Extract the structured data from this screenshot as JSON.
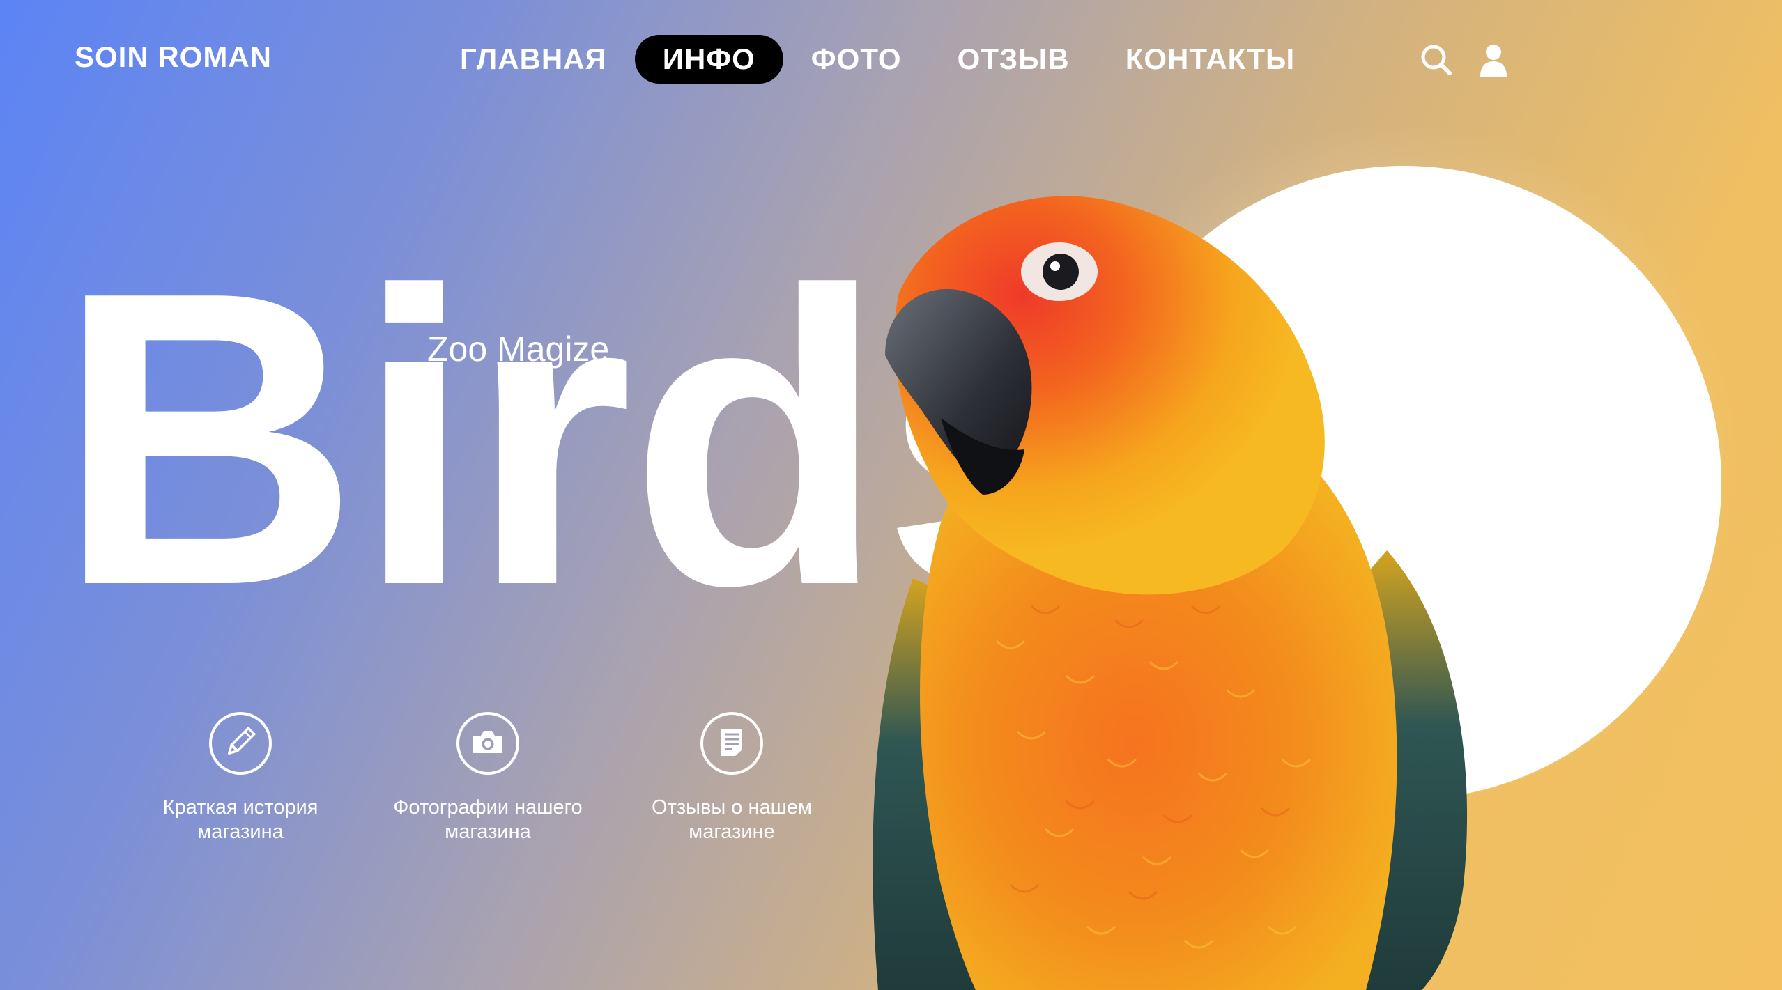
{
  "brand": {
    "name": "SOIN ROMAN"
  },
  "nav": {
    "items": [
      {
        "label": "ГЛАВНАЯ",
        "active": false
      },
      {
        "label": "ИНФО",
        "active": true
      },
      {
        "label": "ФОТО",
        "active": false
      },
      {
        "label": "ОТЗЫВ",
        "active": false
      },
      {
        "label": "КОНТАКТЫ",
        "active": false
      }
    ],
    "icons": [
      "search-icon",
      "user-icon"
    ]
  },
  "hero": {
    "title": "Birds",
    "subtitle": "Zoo Magize"
  },
  "features": [
    {
      "icon": "pencil-icon",
      "label": "Краткая история\nмагазина"
    },
    {
      "icon": "camera-icon",
      "label": "Фотографии нашего\nмагазина"
    },
    {
      "icon": "document-icon",
      "label": "Отзывы о нашем\nмагазине"
    }
  ],
  "colors": {
    "gradient_left": "#5c84f5",
    "gradient_mid": "#a9a2b0",
    "gradient_right": "#f4c05f",
    "active_nav_bg": "#000000",
    "circle": "#ffffff"
  }
}
